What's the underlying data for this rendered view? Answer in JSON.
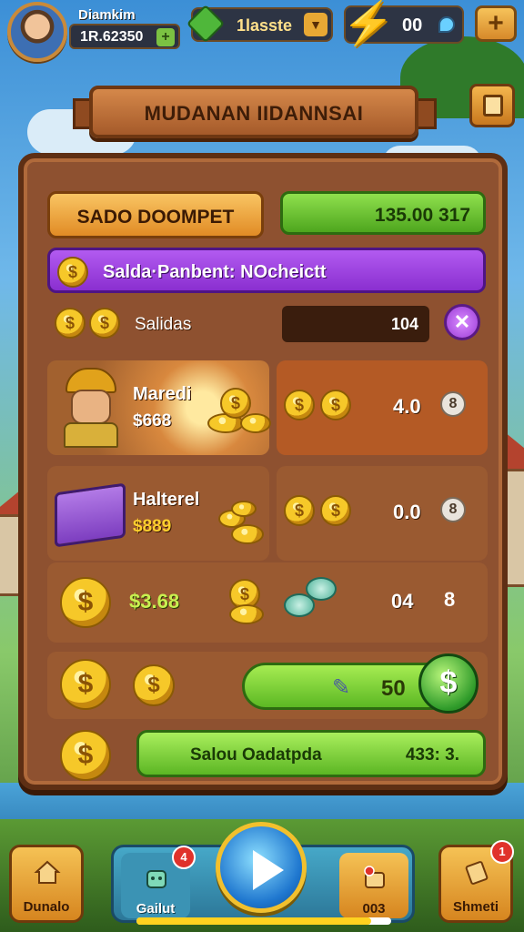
{
  "player": {
    "name": "Diamkim",
    "id": "1R.62350"
  },
  "currencies": {
    "gems_label": "1lasste",
    "energy_value": "00"
  },
  "title_banner": "MUDANAN IIDANNSAI",
  "wallet": {
    "label": "SADO DOOMPET",
    "balance": "135.00 317"
  },
  "promo_text": "Salda·Panbent: NOcheictt",
  "salidas": {
    "label": "Salidas",
    "value": "104"
  },
  "items": [
    {
      "name": "Maredi",
      "price": "$668",
      "value": "4.0",
      "icon": "miner-avatar"
    },
    {
      "name": "Halterel",
      "price": "$889",
      "value": "0.0",
      "icon": "treasure-chest"
    }
  ],
  "coin_row": {
    "amount": "$3.68",
    "value": "04",
    "icon_value": "8"
  },
  "claim": {
    "value": "50",
    "badge_symbol": "$"
  },
  "footer": {
    "label": "Salou Oadatpda",
    "value": "433: 3."
  },
  "bottom_nav": {
    "home_label": "Dunalo",
    "gift_label": "Gailut",
    "gift_badge": "4",
    "bag_label": "003",
    "shop_label": "Shmeti",
    "shop_badge": "1"
  },
  "progress": 0.92,
  "colors": {
    "panel": "#8e5130",
    "accent_green": "#5cb824",
    "accent_purple": "#8a2fd0",
    "gold": "#f6c829"
  }
}
